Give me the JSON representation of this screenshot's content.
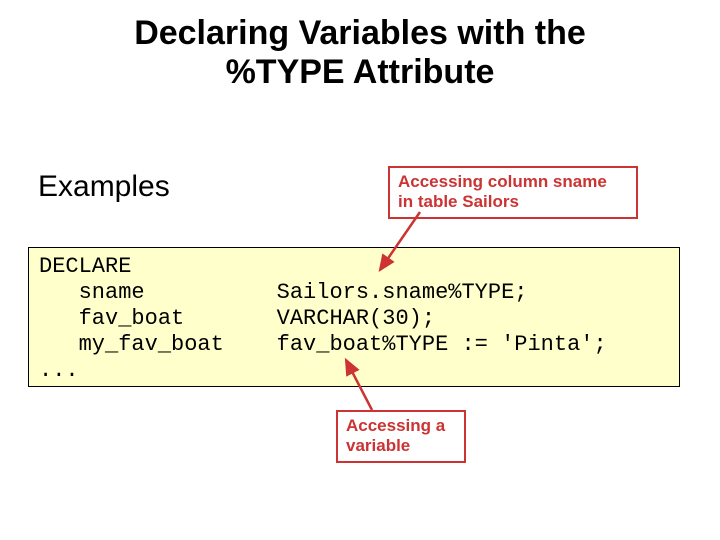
{
  "title_line1": "Declaring Variables with the",
  "title_line2": "%TYPE Attribute",
  "subheading": "Examples",
  "callout_top_line1": "Accessing  column sname",
  "callout_top_line2": "in table Sailors",
  "callout_bottom_line1": "Accessing a",
  "callout_bottom_line2": "variable",
  "code": {
    "l1": "DECLARE",
    "l2": "   sname          Sailors.sname%TYPE;",
    "l3": "   fav_boat       VARCHAR(30);",
    "l4": "   my_fav_boat    fav_boat%TYPE := 'Pinta';",
    "l5": "..."
  },
  "colors": {
    "callout_border": "#cc3333",
    "code_bg": "#ffffcc"
  }
}
